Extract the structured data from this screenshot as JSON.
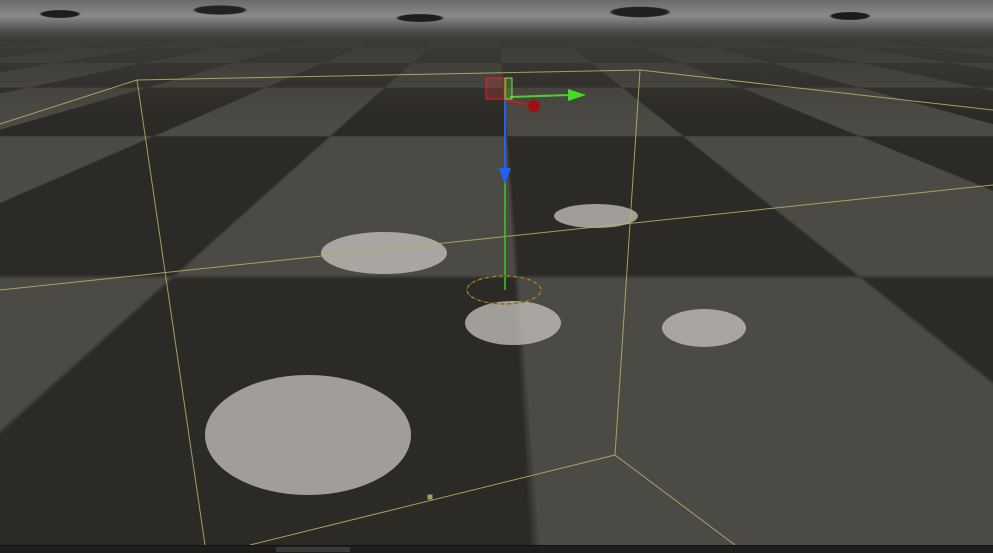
{
  "viewport": {
    "bounds_color": "#b8b46a",
    "gizmo": {
      "x_color": "#e02020",
      "y_color": "#30d020",
      "z_color": "#2060ff"
    },
    "light_spots": 5
  }
}
